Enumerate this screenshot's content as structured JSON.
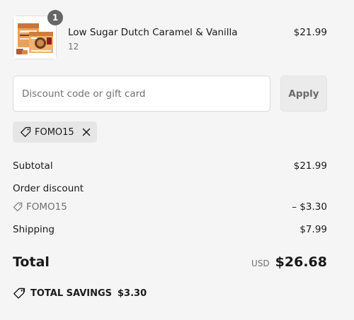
{
  "line_item": {
    "quantity": "1",
    "name": "Low Sugar Dutch Caramel & Vanilla",
    "variant": "12",
    "price": "$21.99"
  },
  "discount": {
    "placeholder": "Discount code or gift card",
    "apply_label": "Apply",
    "applied_code": "FOMO15"
  },
  "summary": {
    "subtotal_label": "Subtotal",
    "subtotal_value": "$21.99",
    "order_discount_label": "Order discount",
    "discount_code": "FOMO15",
    "discount_value": "– $3.30",
    "shipping_label": "Shipping",
    "shipping_value": "$7.99",
    "total_label": "Total",
    "currency": "USD",
    "total_value": "$26.68",
    "savings_label": "TOTAL SAVINGS",
    "savings_value": "$3.30"
  }
}
